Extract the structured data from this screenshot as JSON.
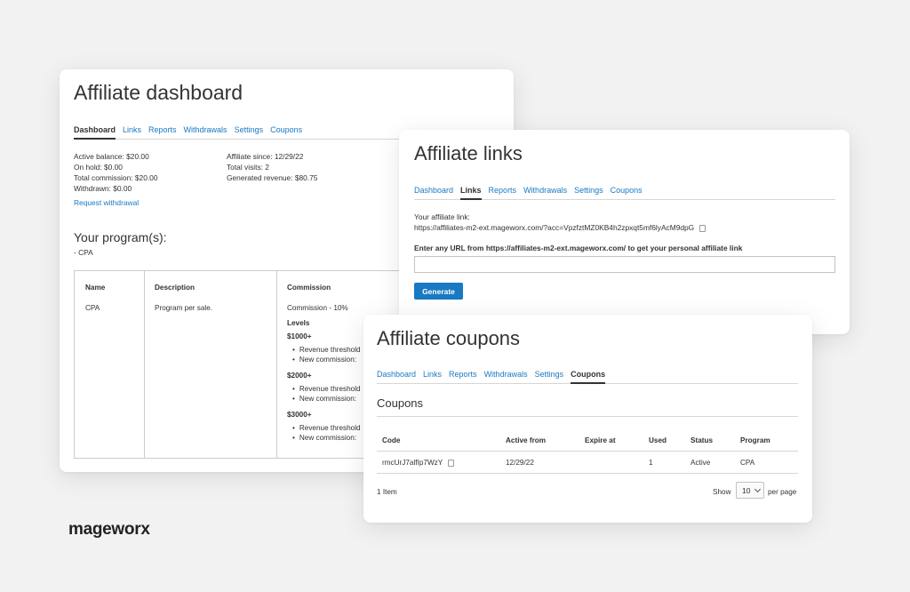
{
  "dashboard": {
    "title": "Affiliate dashboard",
    "tabs": [
      "Dashboard",
      "Links",
      "Reports",
      "Withdrawals",
      "Settings",
      "Coupons"
    ],
    "active_tab": 0,
    "stats_left": [
      "Active balance: $20.00",
      "On hold: $0.00",
      "Total commission: $20.00",
      "Withdrawn: $0.00"
    ],
    "stats_right": [
      "Affiliate since: 12/29/22",
      "Total visits: 2",
      "Generated revenue: $80.75"
    ],
    "request_withdrawal": "Request withdrawal",
    "programs_title": "Your program(s):",
    "programs_list": "- CPA",
    "table": {
      "headers": [
        "Name",
        "Description",
        "Commission"
      ],
      "name": "CPA",
      "description": "Program per sale.",
      "commission": "Commission - 10%",
      "levels_label": "Levels",
      "levels": [
        {
          "label": "$1000+",
          "lines": [
            "Revenue threshold",
            "New commission: "
          ]
        },
        {
          "label": "$2000+",
          "lines": [
            "Revenue threshold",
            "New commission: "
          ]
        },
        {
          "label": "$3000+",
          "lines": [
            "Revenue threshold",
            "New commission: "
          ]
        }
      ]
    }
  },
  "links": {
    "title": "Affiliate links",
    "tabs": [
      "Dashboard",
      "Links",
      "Reports",
      "Withdrawals",
      "Settings",
      "Coupons"
    ],
    "active_tab": 1,
    "your_link_label": "Your affiliate link:",
    "your_link_value": "https://affiliates-m2-ext.mageworx.com/?acc=VpzfztMZ0KB4h2zpxqt5mf6lyAcM9dpG",
    "enter_url_label": "Enter any URL from https://affiliates-m2-ext.mageworx.com/ to get your personal affiliate link",
    "url_input_value": "",
    "generate_button": "Generate"
  },
  "coupons": {
    "title": "Affiliate coupons",
    "tabs": [
      "Dashboard",
      "Links",
      "Reports",
      "Withdrawals",
      "Settings",
      "Coupons"
    ],
    "active_tab": 5,
    "section_title": "Coupons",
    "table_headers": [
      "Code",
      "Active from",
      "Expire at",
      "Used",
      "Status",
      "Program"
    ],
    "rows": [
      {
        "code": "rmcUrJ7alfIp7WzY",
        "active_from": "12/29/22",
        "expire_at": "",
        "used": "1",
        "status": "Active",
        "program": "CPA"
      }
    ],
    "item_count": "1 Item",
    "show_label": "Show",
    "per_page_value": "10",
    "per_page_label": "per page"
  },
  "brand": {
    "logo_text": "mageworx"
  },
  "colors": {
    "link": "#1979c3",
    "button": "#1979c3",
    "background": "#f2f2f2"
  }
}
